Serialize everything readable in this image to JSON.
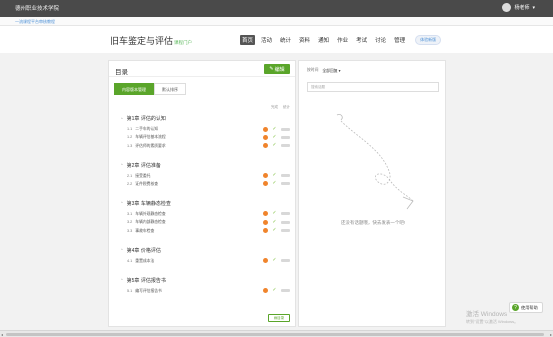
{
  "topbar": {
    "school": "德州职业技术学院",
    "user": "杨老师"
  },
  "breadcrumb": "一流课程平台审核教程",
  "course": {
    "title": "旧车鉴定与评估",
    "subtitle": "课程门户"
  },
  "nav": {
    "items": [
      "首页",
      "活动",
      "统计",
      "资料",
      "通知",
      "作业",
      "考试",
      "讨论",
      "管理"
    ],
    "active": "首页",
    "pill": "体验新版"
  },
  "outline": {
    "title": "目录",
    "edit_label": "编辑",
    "tabs": [
      "内容版本管理",
      "默认排序"
    ],
    "col_headers": [
      "完成",
      "统计"
    ],
    "dir_button": "目录",
    "chapters": [
      {
        "title": "第1章 评估的认知",
        "sections": [
          {
            "num": "1.1",
            "title": "二手车的认知",
            "status": "warn"
          },
          {
            "num": "1.2",
            "title": "车辆评估基本流程",
            "status": "warn"
          },
          {
            "num": "1.3",
            "title": "评估师的素质要求",
            "status": "warn"
          }
        ]
      },
      {
        "title": "第2章 评估准备",
        "sections": [
          {
            "num": "2.1",
            "title": "接受委托",
            "status": "warn"
          },
          {
            "num": "2.2",
            "title": "证件税费核查",
            "status": "warn"
          }
        ]
      },
      {
        "title": "第3章 车辆静态检查",
        "sections": [
          {
            "num": "3.1",
            "title": "车辆外观静态检查",
            "status": "warn"
          },
          {
            "num": "3.2",
            "title": "车辆内部静态检查",
            "status": "warn"
          },
          {
            "num": "3.3",
            "title": "事故车检查",
            "status": "warn"
          }
        ]
      },
      {
        "title": "第4章 价格评估",
        "sections": [
          {
            "num": "4.1",
            "title": "重置成本法",
            "status": "warn"
          }
        ]
      },
      {
        "title": "第5章 评估报告书",
        "sections": [
          {
            "num": "5.1",
            "title": "编写评估报告书",
            "status": "warn"
          }
        ]
      }
    ]
  },
  "discussion": {
    "filter_label": "按时间",
    "filter_value": "全部回复",
    "search_placeholder": "搜索话题",
    "empty_text": "还没有话题哦，快去发表一个吧!"
  },
  "help_label": "使用帮助",
  "watermark": {
    "line1": "激活 Windows",
    "line2": "转到\"设置\"以激活 Windows。"
  },
  "colors": {
    "accent": "#5aa52a",
    "warn": "#f0842c",
    "topbar": "#4a4a4a",
    "link": "#4a8fd6"
  }
}
